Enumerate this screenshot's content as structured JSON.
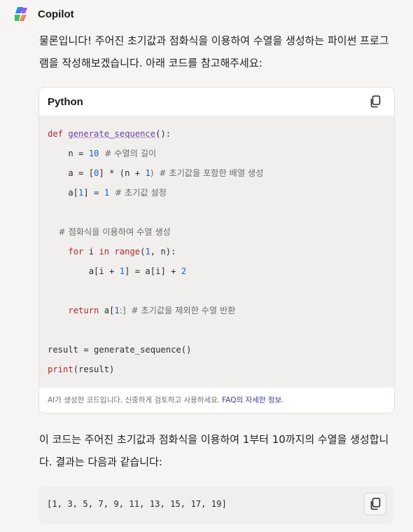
{
  "app": {
    "name": "Copilot"
  },
  "message": {
    "intro": "물론입니다! 주어진 초기값과 점화식을 이용하여 수열을 생성하는 파이썬 프로그램을 작성해보겠습니다. 아래 코드를 참고해주세요:",
    "outro": "이 코드는 주어진 초기값과 점화식을 이용하여 1부터 10까지의 수열을 생성합니다. 결과는 다음과 같습니다:"
  },
  "code_block": {
    "language": "Python",
    "copy_icon": "copy-icon",
    "lines": [
      [
        {
          "t": "def ",
          "c": "kw"
        },
        {
          "t": "generate_sequence",
          "c": "fn"
        },
        {
          "t": "():",
          "c": ""
        }
      ],
      [
        {
          "t": "    n = ",
          "c": ""
        },
        {
          "t": "10",
          "c": "num"
        },
        {
          "t": "  # 수열의 길이",
          "c": "cm"
        }
      ],
      [
        {
          "t": "    a = [",
          "c": ""
        },
        {
          "t": "0",
          "c": "num"
        },
        {
          "t": "] * (n + ",
          "c": ""
        },
        {
          "t": "1",
          "c": "num"
        },
        {
          "t": ")  # 초기값을 포함한 배열 생성",
          "c": "cm"
        }
      ],
      [
        {
          "t": "    a[",
          "c": ""
        },
        {
          "t": "1",
          "c": "num"
        },
        {
          "t": "] = ",
          "c": ""
        },
        {
          "t": "1",
          "c": "num"
        },
        {
          "t": "  # 초기값 설정",
          "c": "cm"
        }
      ],
      [],
      [
        {
          "t": "    # 점화식을 이용하여 수열 생성",
          "c": "cm"
        }
      ],
      [
        {
          "t": "    ",
          "c": ""
        },
        {
          "t": "for",
          "c": "kw"
        },
        {
          "t": " i ",
          "c": ""
        },
        {
          "t": "in",
          "c": "kw"
        },
        {
          "t": " ",
          "c": ""
        },
        {
          "t": "range",
          "c": "bi"
        },
        {
          "t": "(",
          "c": ""
        },
        {
          "t": "1",
          "c": "num"
        },
        {
          "t": ", n):",
          "c": ""
        }
      ],
      [
        {
          "t": "        a[i + ",
          "c": ""
        },
        {
          "t": "1",
          "c": "num"
        },
        {
          "t": "] = a[i] + ",
          "c": ""
        },
        {
          "t": "2",
          "c": "num"
        }
      ],
      [],
      [
        {
          "t": "    ",
          "c": ""
        },
        {
          "t": "return",
          "c": "kw"
        },
        {
          "t": " a[",
          "c": ""
        },
        {
          "t": "1",
          "c": "num"
        },
        {
          "t": ":]  # 초기값을 제외한 수열 반환",
          "c": "cm"
        }
      ],
      [],
      [
        {
          "t": "result = generate_sequence()",
          "c": ""
        }
      ],
      [
        {
          "t": "print",
          "c": "bi"
        },
        {
          "t": "(result)",
          "c": ""
        }
      ]
    ],
    "footer_text": "AI가 생성한 코드입니다. 신중하게 검토하고 사용하세요.",
    "footer_link": "FAQ의 자세한 정보."
  },
  "output_block": {
    "text": "[1, 3, 5, 7, 9, 11, 13, 15, 17, 19]",
    "copy_icon": "copy-icon"
  }
}
